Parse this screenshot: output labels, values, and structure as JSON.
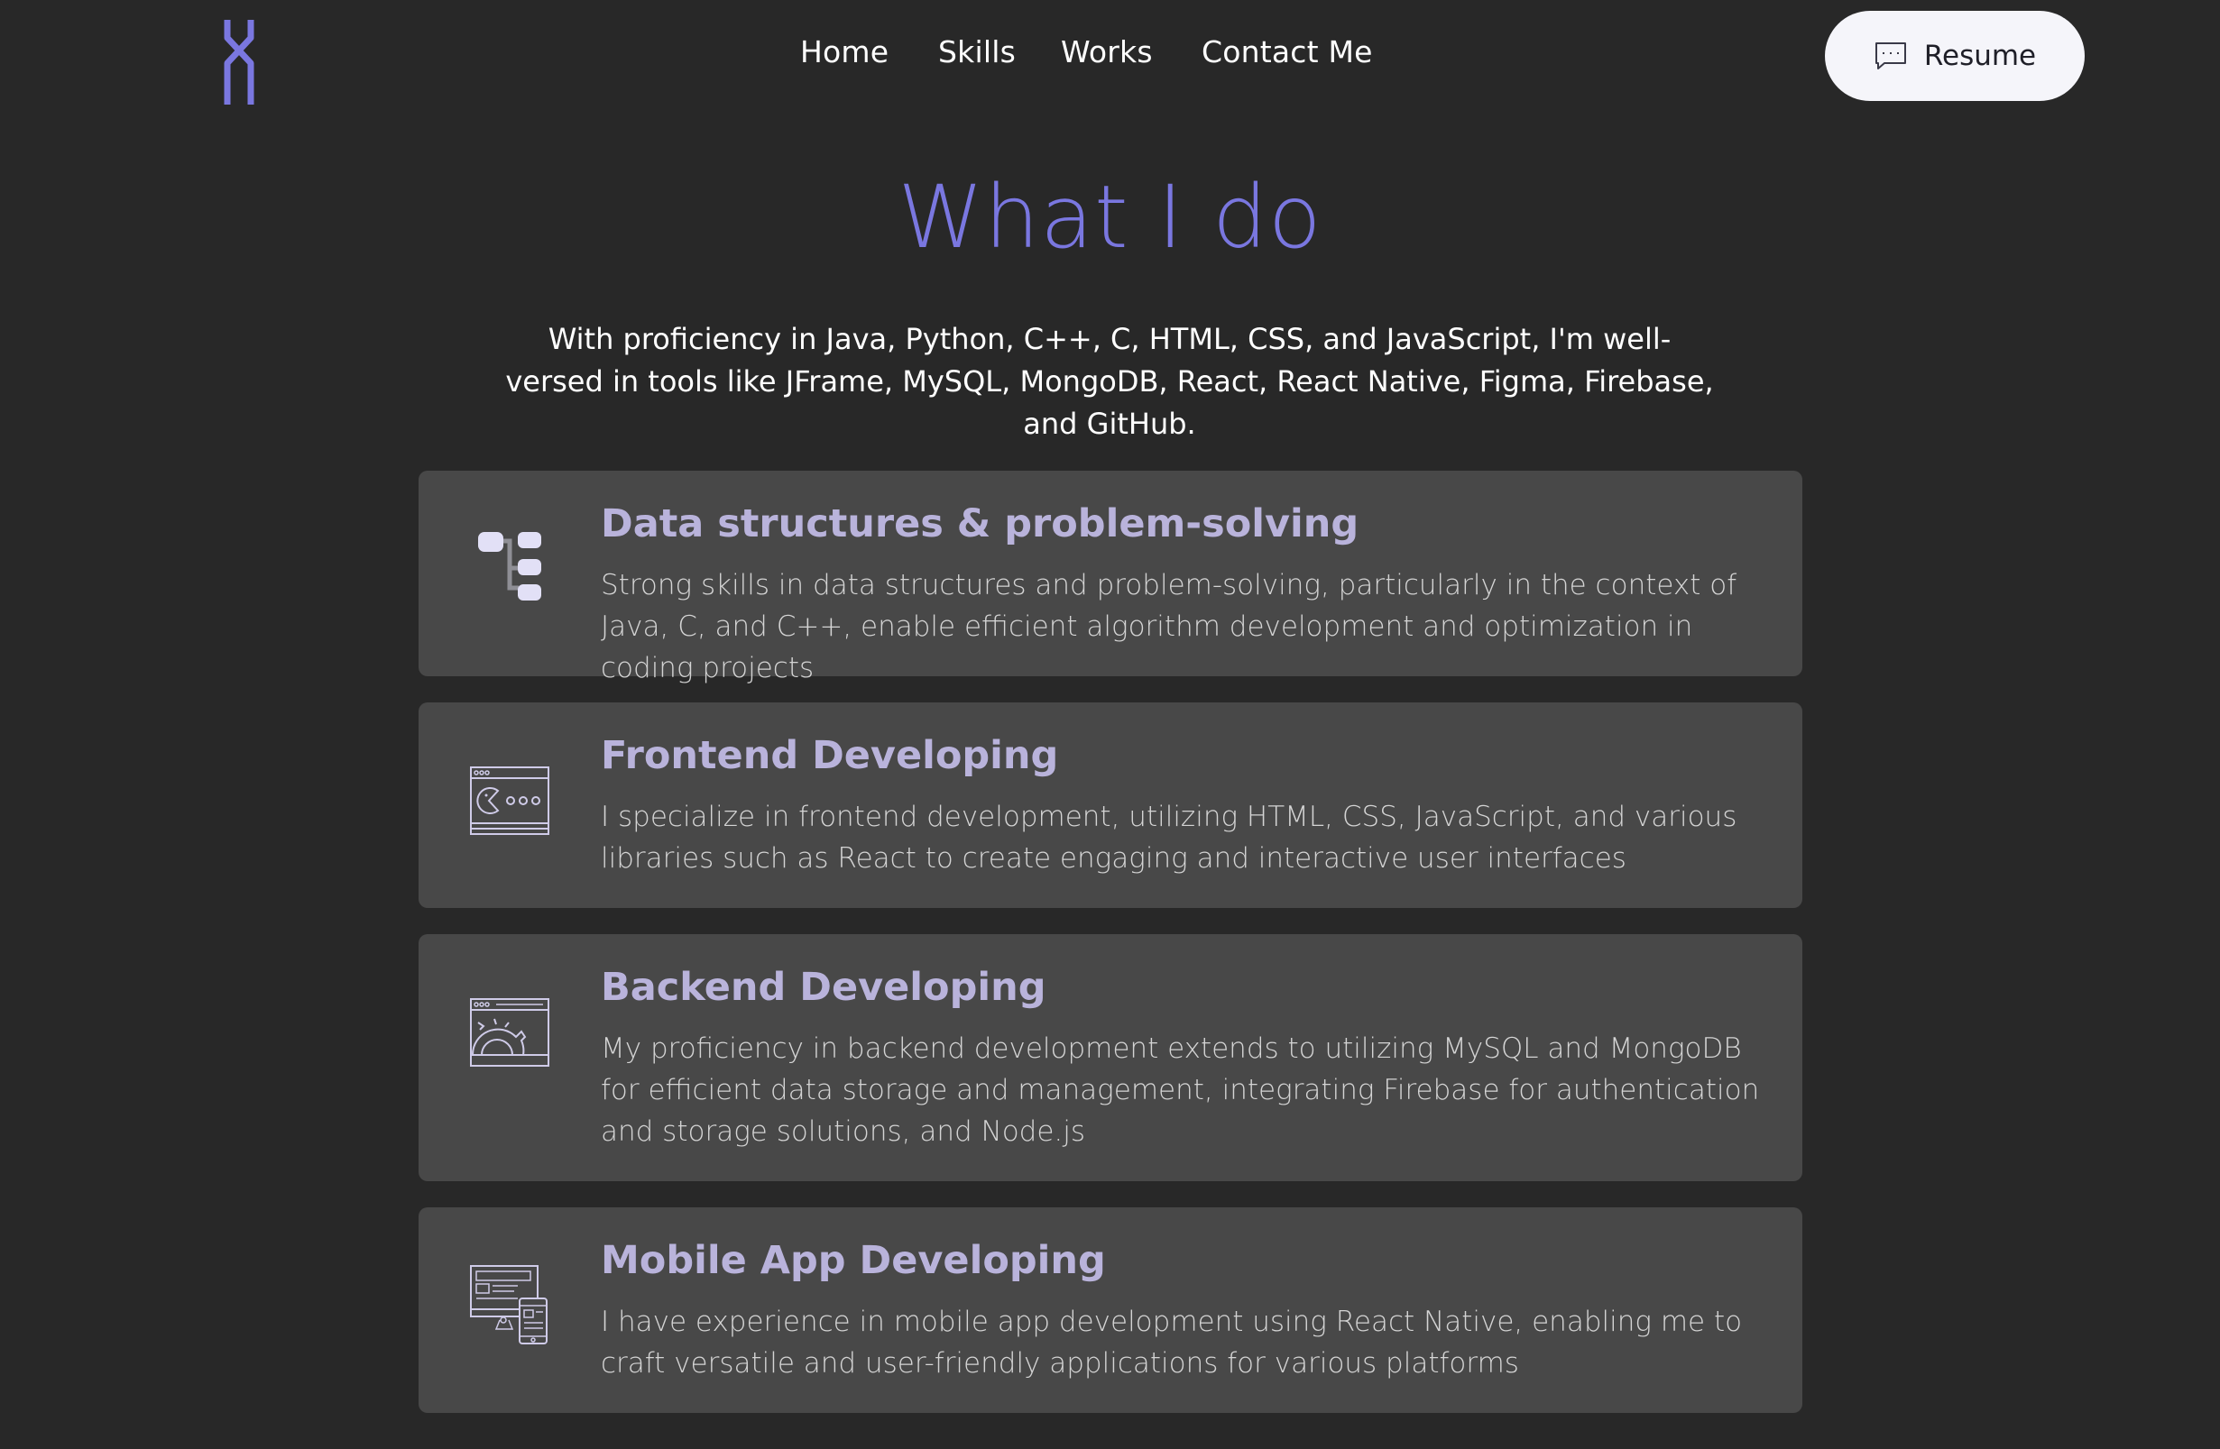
{
  "nav": {
    "links": [
      "Home",
      "Skills",
      "Works",
      "Contact Me"
    ],
    "resume_label": "Resume"
  },
  "hero": {
    "title": "What I do",
    "description": "With proficiency in Java, Python, C++, C, HTML, CSS, and JavaScript, I'm well-versed in tools like JFrame, MySQL, MongoDB, React, React Native, Figma, Firebase, and GitHub."
  },
  "cards": [
    {
      "icon": "data-structure-icon",
      "title": "Data structures & problem-solving",
      "description": "Strong skills in data structures and problem-solving, particularly in the context of Java, C, and C++, enable efficient algorithm development and optimization in coding projects"
    },
    {
      "icon": "frontend-window-icon",
      "title": "Frontend Developing",
      "description": "I specialize in frontend development, utilizing HTML, CSS, JavaScript, and various libraries such as React to create engaging and interactive user interfaces"
    },
    {
      "icon": "backend-gear-window-icon",
      "title": "Backend Developing",
      "description": "My proficiency in backend development extends to utilizing MySQL and MongoDB for efficient data storage and management, integrating Firebase for authentication and storage solutions, and Node.js"
    },
    {
      "icon": "mobile-devices-icon",
      "title": "Mobile App Developing",
      "description": "I have experience in mobile app development using React Native, enabling me to craft versatile and user-friendly applications for various platforms"
    }
  ],
  "colors": {
    "background": "#282828",
    "card": "#484848",
    "accent": "#7a77e0",
    "card_title": "#b9b3db"
  }
}
